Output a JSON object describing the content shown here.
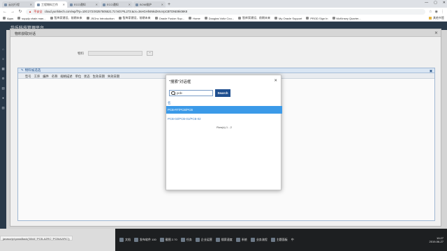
{
  "browser": {
    "tabs": [
      {
        "label": "云出行程",
        "active": false
      },
      {
        "label": "工程物料工作",
        "active": true
      },
      {
        "label": "ECO通知",
        "active": false
      },
      {
        "label": "ECO通知",
        "active": false
      },
      {
        "label": "BOM维护",
        "active": false
      }
    ],
    "new_tab_icon": "+",
    "window_controls": [
      "—",
      "▢",
      "✕"
    ],
    "address": {
      "security_label": "不安全",
      "url": "cloud.yunhitech.com/wp/f?p=100:273:00257505521:72:NO:PIL273:&cs=3sHGHh6NkdXKxVpCBTDNE9k08K8"
    },
    "bookmarks": [
      "Apps",
      "supply chain man...",
      "智库家建设、前期未来",
      "JSOnc Introduction",
      "智库家建设、前期未来",
      "Oracle Fusion Sup...",
      "Home",
      "Douglas Voltz Cou...",
      "智库家建设、前期未来",
      "My Oracle Support",
      "PROD Sign In",
      "McKinsey Quarter..."
    ],
    "bookmarks_right": "其他书签",
    "status_url": "javascript:passBack('6544','PCB-A2RC','PCB/A2/RC');"
  },
  "app": {
    "title": "华乐科技管理平台",
    "outer_dialog": {
      "title": "物料获取对话",
      "field_label": "物料",
      "grid_title": "物料候选选",
      "columns": [
        "型号",
        "工序",
        "编件",
        "名称",
        "规格描述",
        "单位",
        "状态",
        "生效日期",
        "失效日期"
      ]
    }
  },
  "modal": {
    "title": "\"搜索\"对话框",
    "search_value": "pcb-",
    "search_placeholder": "",
    "search_button": "Search",
    "list_header": "名",
    "rows": [
      {
        "text": "PCB-RT/PCB/PCB",
        "selected": true
      },
      {
        "text": "PCB-02/PCB-01/PCB-02",
        "selected": false
      }
    ],
    "pager": "Row(s) 1 - 2"
  },
  "taskbar": {
    "items": [
      "文档",
      "发布软件 100",
      "截图 2.70",
      "任务",
      "企业运营",
      "搜索速度",
      "系统",
      "业务流程",
      "主题面板"
    ],
    "clock_time": "10:27",
    "clock_date": "2019-06-27",
    "ime": "中"
  },
  "colors": {
    "app_header": "#2d3e50",
    "selected_row": "#3b9ae8",
    "search_button": "#1f4f8f",
    "link_blue": "#3f7fc1"
  }
}
